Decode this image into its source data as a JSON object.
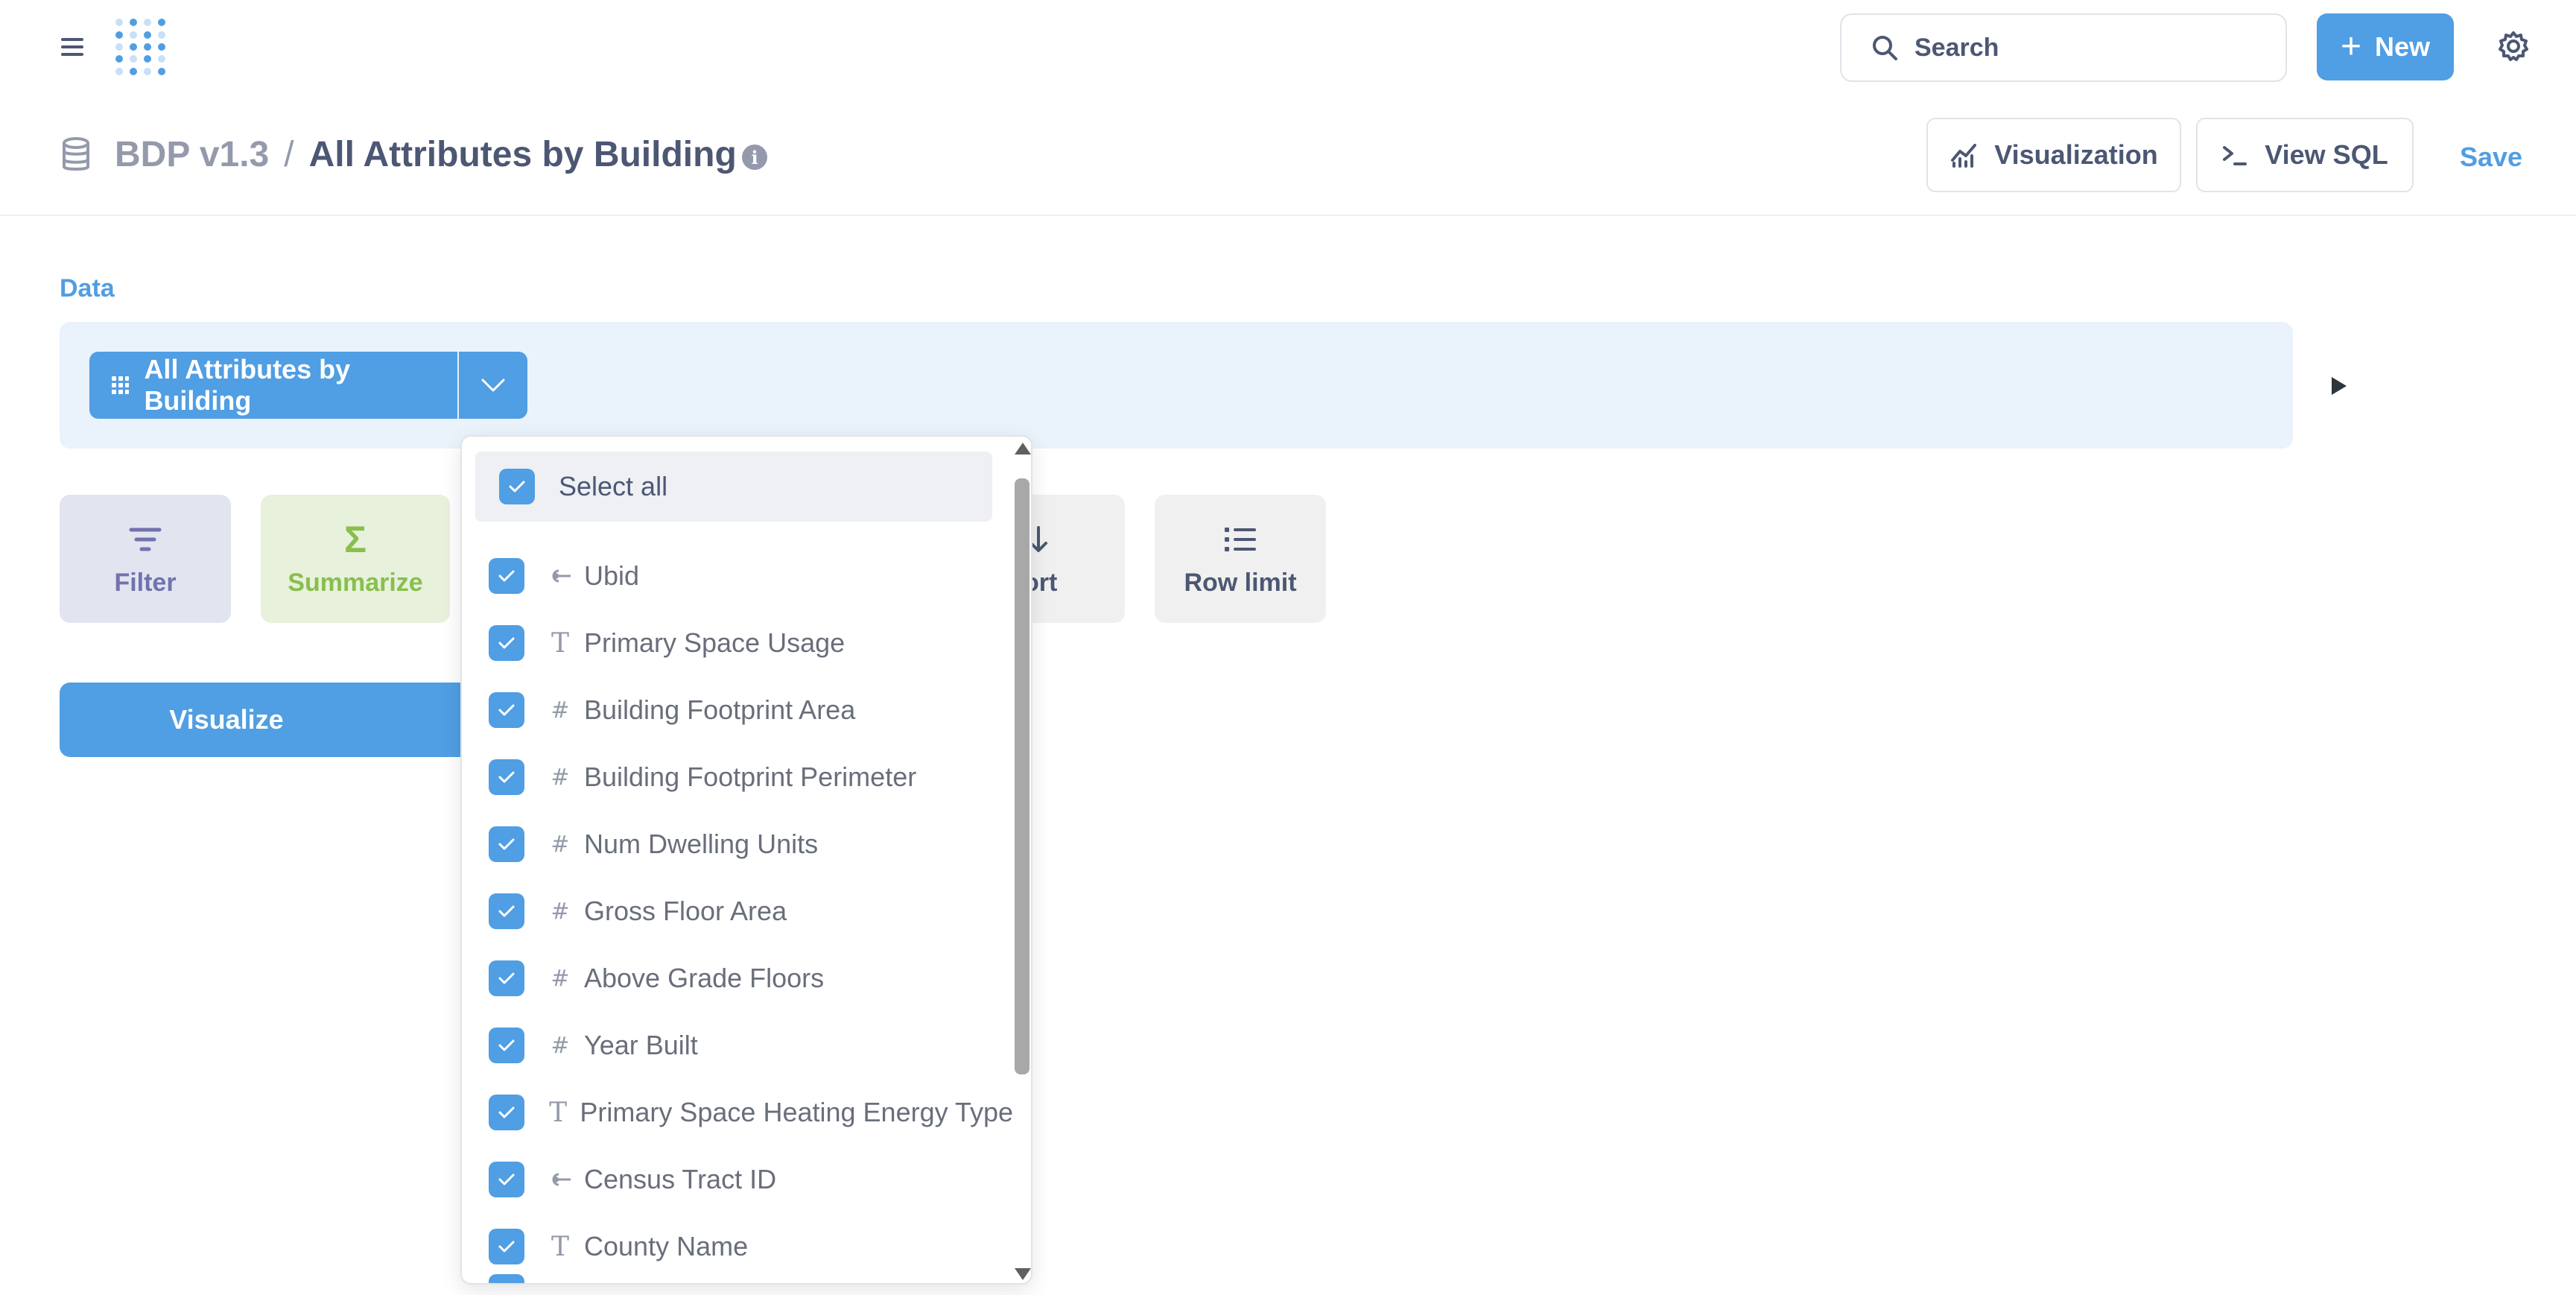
{
  "nav": {
    "search_label": "Search",
    "new_label": "New",
    "new_plus": "+"
  },
  "header": {
    "database": "BDP v1.3",
    "separator": "/",
    "question_title": "All Attributes by Building",
    "info_glyph": "i",
    "visualization_label": "Visualization",
    "view_sql_label": "View SQL",
    "save_label": "Save"
  },
  "data_section": {
    "label": "Data",
    "source_name": "All Attributes by Building"
  },
  "actions": {
    "filter": "Filter",
    "summarize": "Summarize",
    "summarize_glyph": "Σ",
    "sort": "ort",
    "row_limit": "Row limit",
    "visualize": "Visualize"
  },
  "dropdown": {
    "select_all_label": "Select all",
    "select_all_checked": true,
    "columns": [
      {
        "name": "Ubid",
        "type": "fk",
        "checked": true
      },
      {
        "name": "Primary Space Usage",
        "type": "text",
        "checked": true
      },
      {
        "name": "Building Footprint Area",
        "type": "number",
        "checked": true
      },
      {
        "name": "Building Footprint Perimeter",
        "type": "number",
        "checked": true
      },
      {
        "name": "Num Dwelling Units",
        "type": "number",
        "checked": true
      },
      {
        "name": "Gross Floor Area",
        "type": "number",
        "checked": true
      },
      {
        "name": "Above Grade Floors",
        "type": "number",
        "checked": true
      },
      {
        "name": "Year Built",
        "type": "number",
        "checked": true
      },
      {
        "name": "Primary Space Heating Energy Type",
        "type": "text",
        "checked": true
      },
      {
        "name": "Census Tract ID",
        "type": "fk",
        "checked": true
      },
      {
        "name": "County Name",
        "type": "text",
        "checked": true
      }
    ],
    "type_glyphs": {
      "text": "T",
      "number": "#"
    }
  },
  "colors": {
    "brand": "#509ee3",
    "filter_tile": "#7172ad",
    "summarize_tile": "#88bf4d",
    "text_dark": "#4c5773",
    "text_muted": "#949aab"
  },
  "icons": {
    "menu": "hamburger-icon",
    "search": "search-icon",
    "settings": "gear-icon",
    "database": "database-icon",
    "info": "info-icon",
    "visualization": "chart-line-icon",
    "sql": "terminal-icon",
    "table": "grid-icon",
    "toggle": "chevron-down-icon",
    "run": "play-icon",
    "filter": "filter-icon",
    "summarize": "sigma-icon",
    "sort": "sort-icon",
    "row_limit": "list-icon",
    "foreign_key": "connection-icon"
  }
}
